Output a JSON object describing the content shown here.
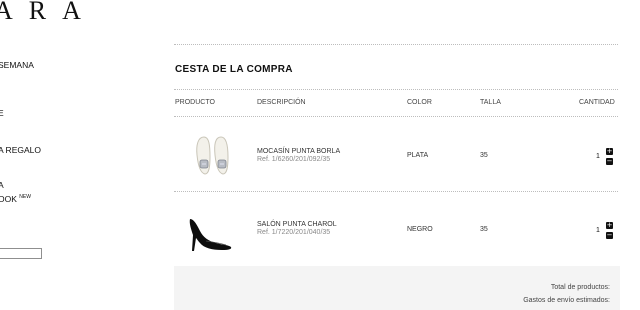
{
  "brand": {
    "logo_text": "ARA"
  },
  "sidebar": {
    "items": [
      {
        "label": "SEMANA"
      },
      {
        "label": "E"
      },
      {
        "label": "A REGALO"
      },
      {
        "label": "A"
      },
      {
        "label": "OOK",
        "badge": "NEW"
      }
    ],
    "search": {
      "value": ""
    }
  },
  "cart": {
    "title": "CESTA DE LA COMPRA",
    "columns": {
      "product": "PRODUCTO",
      "description": "DESCRIPCIÓN",
      "color": "COLOR",
      "size": "TALLA",
      "quantity": "CANTIDAD"
    },
    "items": [
      {
        "image_icon": "loafer-shoes-icon",
        "name": "MOCASÍN PUNTA BORLA",
        "ref": "Ref. 1/6260/201/092/35",
        "color": "PLATA",
        "size": "35",
        "quantity": "1"
      },
      {
        "image_icon": "pump-shoe-icon",
        "name": "SALÓN PUNTA CHAROL",
        "ref": "Ref. 1/7220/201/040/35",
        "color": "NEGRO",
        "size": "35",
        "quantity": "1"
      }
    ],
    "qty_plus": "+",
    "qty_minus": "−"
  },
  "totals": {
    "products_label": "Total de productos:",
    "shipping_label": "Gastos de envío estimados:"
  }
}
